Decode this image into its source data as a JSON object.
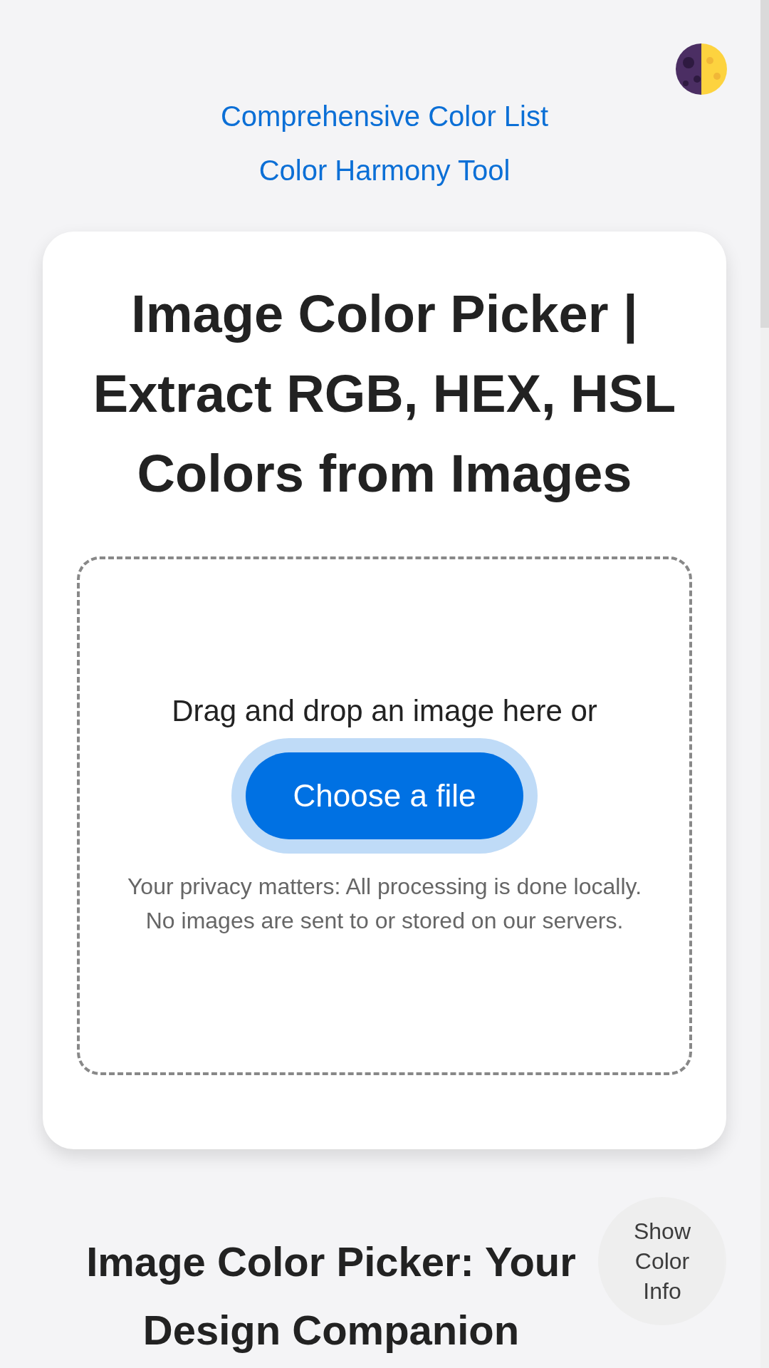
{
  "nav_links": [
    {
      "label": "Comprehensive Color List"
    },
    {
      "label": "Color Harmony Tool"
    }
  ],
  "card": {
    "title": "Image Color Picker | Extract RGB, HEX, HSL Colors from Images",
    "dropzone": {
      "prompt": "Drag and drop an image here or",
      "button": "Choose a file",
      "privacy_note": "Your privacy matters: All processing is done locally. No images are sent to or stored on our servers."
    }
  },
  "color_info_button": "Show Color Info",
  "section_heading": "Image Color Picker: Your Design Companion"
}
